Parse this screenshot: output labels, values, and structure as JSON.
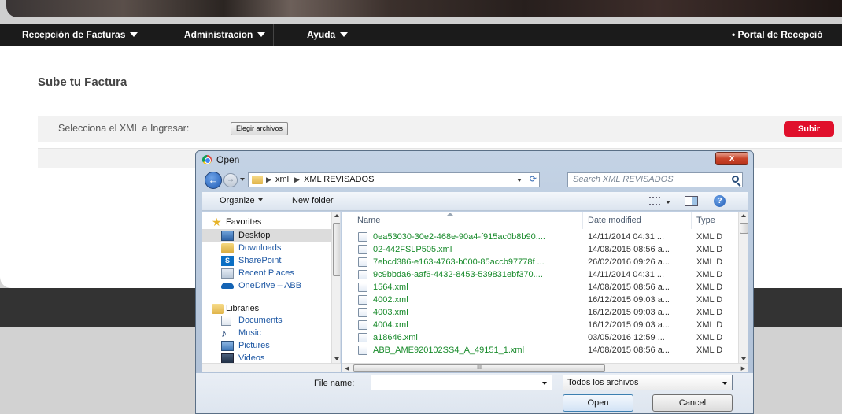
{
  "nav": {
    "items": [
      {
        "label": "Recepción de Facturas"
      },
      {
        "label": "Administracion"
      },
      {
        "label": "Ayuda"
      }
    ],
    "right_label": "• Portal de Recepció"
  },
  "page": {
    "section_title": "Sube tu Factura",
    "upload_label": "Selecciona el XML a Ingresar:",
    "choose_files_label": "Elegir archivos",
    "submit_label": "Subir",
    "accent_color": "#e0102c"
  },
  "dialog": {
    "title": "Open",
    "close_label": "x",
    "breadcrumb": [
      "xml",
      "XML REVISADOS"
    ],
    "search_placeholder": "Search XML REVISADOS",
    "toolbar": {
      "organize_label": "Organize",
      "new_folder_label": "New folder"
    },
    "nav_pane": {
      "favorites_label": "Favorites",
      "favorites": [
        {
          "label": "Desktop",
          "icon": "desktop-icon"
        },
        {
          "label": "Downloads",
          "icon": "downloads-icon"
        },
        {
          "label": "SharePoint",
          "icon": "sharepoint-icon"
        },
        {
          "label": "Recent Places",
          "icon": "recent-places-icon"
        },
        {
          "label": "OneDrive – ABB",
          "icon": "onedrive-icon"
        }
      ],
      "libraries_label": "Libraries",
      "libraries": [
        {
          "label": "Documents",
          "icon": "documents-icon"
        },
        {
          "label": "Music",
          "icon": "music-icon"
        },
        {
          "label": "Pictures",
          "icon": "pictures-icon"
        },
        {
          "label": "Videos",
          "icon": "videos-icon"
        }
      ]
    },
    "columns": {
      "name": "Name",
      "date": "Date modified",
      "type": "Type"
    },
    "files": [
      {
        "name": "0ea53030-30e2-468e-90a4-f915ac0b8b90....",
        "date": "14/11/2014 04:31 ...",
        "type": "XML D"
      },
      {
        "name": "02-442FSLP505.xml",
        "date": "14/08/2015 08:56 a...",
        "type": "XML D"
      },
      {
        "name": "7ebcd386-e163-4763-b000-85accb97778f ...",
        "date": "26/02/2016 09:26 a...",
        "type": "XML D"
      },
      {
        "name": "9c9bbda6-aaf6-4432-8453-539831ebf370....",
        "date": "14/11/2014 04:31 ...",
        "type": "XML D"
      },
      {
        "name": "1564.xml",
        "date": "14/08/2015 08:56 a...",
        "type": "XML D"
      },
      {
        "name": "4002.xml",
        "date": "16/12/2015 09:03 a...",
        "type": "XML D"
      },
      {
        "name": "4003.xml",
        "date": "16/12/2015 09:03 a...",
        "type": "XML D"
      },
      {
        "name": "4004.xml",
        "date": "16/12/2015 09:03 a...",
        "type": "XML D"
      },
      {
        "name": "a18646.xml",
        "date": "03/05/2016 12:59 ...",
        "type": "XML D"
      },
      {
        "name": "ABB_AME920102SS4_A_49151_1.xml",
        "date": "14/08/2015 08:56 a...",
        "type": "XML D"
      }
    ],
    "hscroll_grip": "III",
    "file_name_label": "File name:",
    "file_name_value": "",
    "filter_value": "Todos los archivos",
    "open_label": "Open",
    "cancel_label": "Cancel"
  }
}
